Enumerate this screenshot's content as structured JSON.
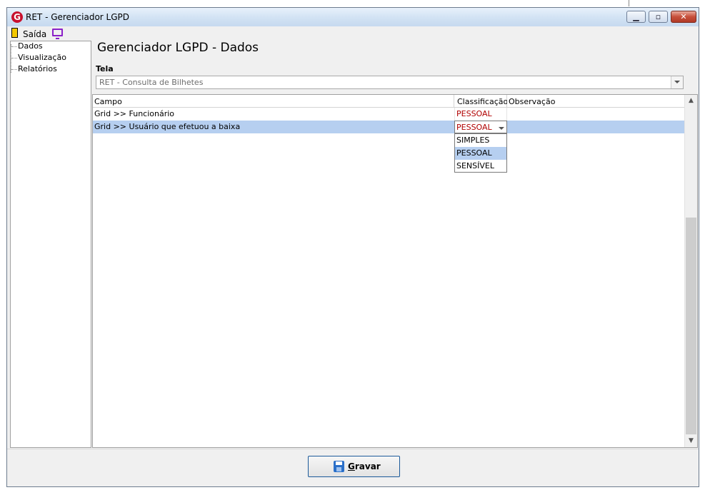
{
  "window": {
    "title": "RET - Gerenciador LGPD",
    "app_icon_letter": "G"
  },
  "menu": {
    "exit_label": "Saída"
  },
  "tree": {
    "items": [
      {
        "label": "Dados"
      },
      {
        "label": "Visualização"
      },
      {
        "label": "Relatórios"
      }
    ]
  },
  "main": {
    "title": "Gerenciador LGPD - Dados",
    "screen_label": "Tela",
    "screen_value": "RET - Consulta de Bilhetes"
  },
  "grid": {
    "columns": [
      "Campo",
      "Classificação",
      "Observação"
    ],
    "rows": [
      {
        "campo": "Grid >> Funcionário",
        "classificacao": "PESSOAL",
        "observacao": "",
        "selected": false
      },
      {
        "campo": "Grid >> Usuário que efetuou a baixa",
        "classificacao": "PESSOAL",
        "observacao": "",
        "selected": true
      }
    ],
    "dropdown_options": [
      "SIMPLES",
      "PESSOAL",
      "SENSÍVEL"
    ],
    "dropdown_highlighted": "PESSOAL"
  },
  "footer": {
    "save_label_prefix": "G",
    "save_label_rest": "ravar"
  },
  "colors": {
    "classification_text": "#b00000",
    "selection": "#b6cff0",
    "close_button": "#c74f3b"
  }
}
